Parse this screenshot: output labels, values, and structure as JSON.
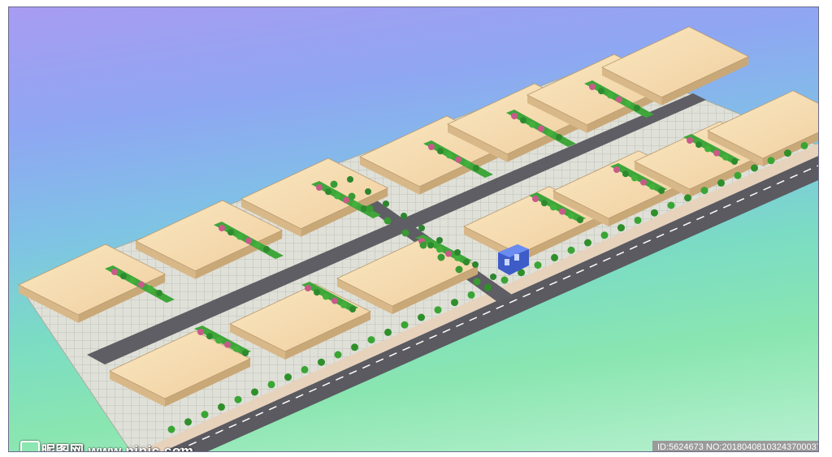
{
  "watermark": {
    "site_text": "昵图网 www.nipic.com",
    "id_text": "ID:5624673 NO:20180408103243700037"
  },
  "colors": {
    "roof": "#f6dcb0",
    "roof_side": "#c9a878",
    "road": "#606066",
    "pavement": "#d9dbd2",
    "lawn": "#3fa63a",
    "guardhouse": "#4a6ee0"
  }
}
